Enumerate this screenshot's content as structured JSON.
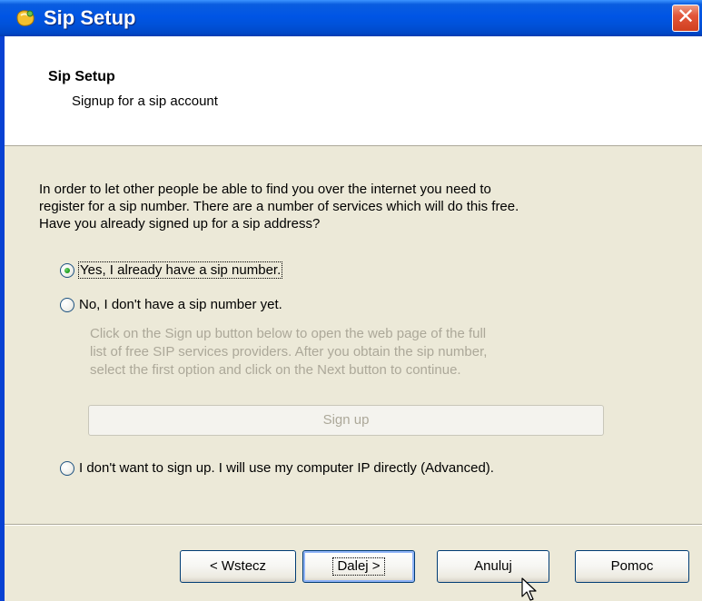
{
  "window": {
    "title": "Sip Setup",
    "close_label": "✕"
  },
  "header": {
    "title": "Sip Setup",
    "subtitle": "Signup for a sip account"
  },
  "content": {
    "intro_line1": "In order to let other people be able to find you over the internet you need to",
    "intro_line2": "register for a sip number. There are a number of services which will do this free.",
    "intro_line3": "Have you already signed up for a sip address?",
    "options": [
      {
        "label": "Yes, I already have a sip number.",
        "checked": true
      },
      {
        "label": "No, I don't have a sip number yet.",
        "checked": false
      },
      {
        "label": "I don't want to sign up. I will use my computer IP directly (Advanced).",
        "checked": false
      }
    ],
    "hint_line1": "Click on the Sign up button below to open the web page of the full",
    "hint_line2": "list of free SIP services providers. After you obtain the sip number,",
    "hint_line3": "select the first option and click on the Next button to continue.",
    "signup_label": "Sign up"
  },
  "footer": {
    "back_label": "< Wstecz",
    "next_label": "Dalej >",
    "cancel_label": "Anuluj",
    "help_label": "Pomoc"
  },
  "colors": {
    "titlebar": "#0055e5",
    "dialog_bg": "#ece9d8",
    "disabled_text": "#aca899",
    "close_button": "#e2563a"
  }
}
